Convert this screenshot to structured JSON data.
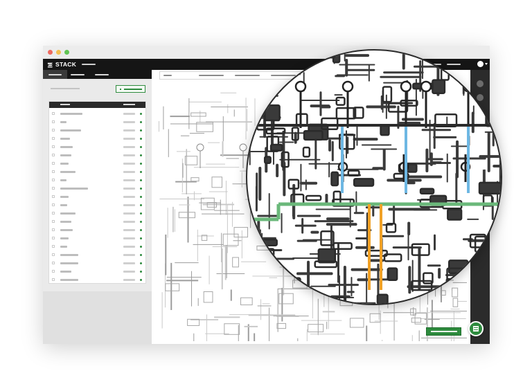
{
  "app": {
    "brand_name": "STACK",
    "colors": {
      "topbar": "#151515",
      "accent_green": "#2e8b3e",
      "pipe_blue": "#6db7e3",
      "pipe_orange": "#f0a126",
      "pipe_green": "#6ab87a"
    }
  },
  "window_controls": {
    "close_icon": "circle-red",
    "minimize_icon": "circle-yellow",
    "maximize_icon": "circle-green"
  },
  "topbar": {
    "logo_icon": "stack-logo-icon",
    "avatar_icon": "user-avatar-icon",
    "menu_icon": "chevron-down-icon"
  },
  "sidebar": {
    "filter_icon": "plus-icon",
    "list_status_icon": "status-dot-icon",
    "row_count": 21
  },
  "canvas": {
    "view_icon": "blueprint-drawing",
    "magnifier_icon": "zoom-lens-icon"
  },
  "right_rail": {
    "icons": [
      "select-tool-icon",
      "measure-tool-icon",
      "layers-icon"
    ]
  },
  "fab": {
    "icon": "chat-icon"
  }
}
